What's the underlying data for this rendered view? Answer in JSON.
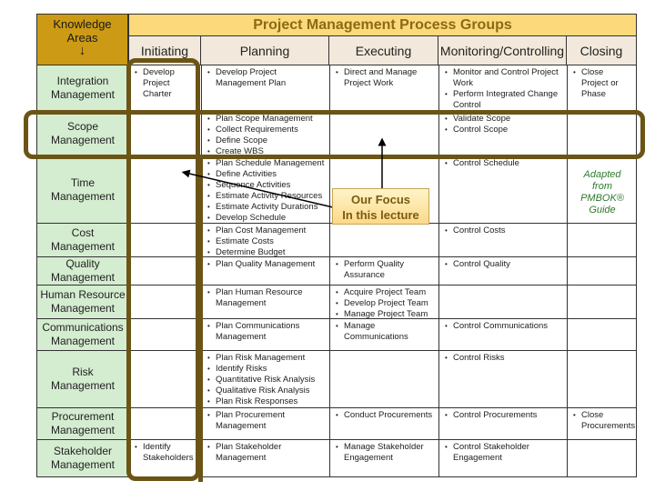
{
  "header": {
    "knowledge_areas": "Knowledge Areas",
    "down_arrow": "↓",
    "process_groups": "Project Management Process Groups",
    "columns": [
      "Initiating",
      "Planning",
      "Executing",
      "Monitoring/Controlling",
      "Closing"
    ]
  },
  "rows": [
    {
      "area": "Integration Management",
      "initiating": [
        "Develop Project Charter"
      ],
      "planning": [
        "Develop Project Management Plan"
      ],
      "executing": [
        "Direct and Manage Project Work"
      ],
      "monitoring": [
        "Monitor and Control Project Work",
        "Perform Integrated Change Control"
      ],
      "closing": [
        "Close Project or Phase"
      ]
    },
    {
      "area": "Scope Management",
      "initiating": [],
      "planning": [
        "Plan Scope Management",
        "Collect Requirements",
        "Define Scope",
        "Create WBS"
      ],
      "executing": [],
      "monitoring": [
        "Validate Scope",
        "Control Scope"
      ],
      "closing": []
    },
    {
      "area": "Time Management",
      "initiating": [],
      "planning": [
        "Plan Schedule Management",
        "Define Activities",
        "Sequence Activities",
        "Estimate Activity Resources",
        "Estimate Activity Durations",
        "Develop Schedule"
      ],
      "executing": [],
      "monitoring": [
        "Control Schedule"
      ],
      "closing": []
    },
    {
      "area": "Cost Management",
      "initiating": [],
      "planning": [
        "Plan Cost Management",
        "Estimate Costs",
        "Determine Budget"
      ],
      "executing": [],
      "monitoring": [
        "Control Costs"
      ],
      "closing": []
    },
    {
      "area": "Quality Management",
      "initiating": [],
      "planning": [
        "Plan Quality Management"
      ],
      "executing": [
        "Perform Quality Assurance"
      ],
      "monitoring": [
        "Control Quality"
      ],
      "closing": []
    },
    {
      "area": "Human Resource Management",
      "initiating": [],
      "planning": [
        "Plan Human Resource Management"
      ],
      "executing": [
        "Acquire Project Team",
        "Develop Project Team",
        "Manage Project Team"
      ],
      "monitoring": [],
      "closing": []
    },
    {
      "area": "Communications Management",
      "initiating": [],
      "planning": [
        "Plan Communications Management"
      ],
      "executing": [
        "Manage Communications"
      ],
      "monitoring": [
        "Control Communications"
      ],
      "closing": []
    },
    {
      "area": "Risk Management",
      "initiating": [],
      "planning": [
        "Plan Risk Management",
        "Identify Risks",
        "Quantitative Risk Analysis",
        "Qualitative Risk Analysis",
        "Plan Risk Responses"
      ],
      "executing": [],
      "monitoring": [
        "Control Risks"
      ],
      "closing": []
    },
    {
      "area": "Procurement Management",
      "initiating": [],
      "planning": [
        "Plan Procurement Management"
      ],
      "executing": [
        "Conduct Procurements"
      ],
      "monitoring": [
        "Control Procurements"
      ],
      "closing": [
        "Close Procurements"
      ]
    },
    {
      "area": "Stakeholder Management",
      "initiating": [
        "Identify Stakeholders"
      ],
      "planning": [
        "Plan Stakeholder Management"
      ],
      "executing": [
        "Manage Stakeholder Engagement"
      ],
      "monitoring": [
        "Control Stakeholder Engagement"
      ],
      "closing": []
    }
  ],
  "callout": {
    "line1": "Our Focus",
    "line2": "In this lecture"
  },
  "note": {
    "line1": "Adapted",
    "line2": "from",
    "line3": "PMBOK®",
    "line4": "Guide"
  },
  "colors": {
    "knowledge_header": "#cc9a14",
    "process_header": "#fcd97a",
    "area_cells": "#d4ecd0",
    "highlight_border": "#6b5416",
    "note_text": "#2e7a2e"
  }
}
